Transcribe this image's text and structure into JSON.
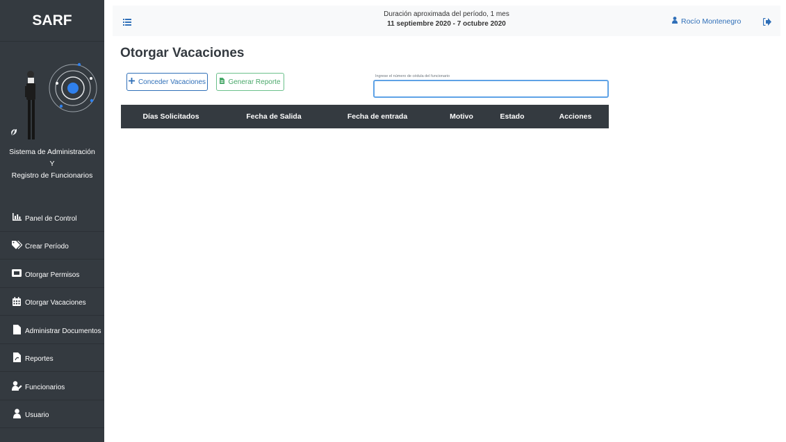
{
  "sidebar": {
    "brand": "SARF",
    "system_line1": "Sistema de Administración",
    "system_line2": "Y",
    "system_line3": "Registro de Funcionarios",
    "items": [
      {
        "label": "Panel de Control",
        "icon": "chart-icon"
      },
      {
        "label": "Crear Período",
        "icon": "tags-icon"
      },
      {
        "label": "Otorgar Permisos",
        "icon": "ticket-icon"
      },
      {
        "label": "Otorgar Vacaciones",
        "icon": "calendar-icon"
      },
      {
        "label": "Administrar Documentos",
        "icon": "file-icon"
      },
      {
        "label": "Reportes",
        "icon": "pdf-file-icon"
      },
      {
        "label": "Funcionarios",
        "icon": "user-edit-icon"
      },
      {
        "label": "Usuario",
        "icon": "user-icon"
      }
    ]
  },
  "topbar": {
    "period_line1": "Duración aproximada del período, 1 mes",
    "period_line2": "11 septiembre 2020 - 7 octubre 2020",
    "user_name": "Rocío Montenegro"
  },
  "main": {
    "title": "Otorgar Vacaciones",
    "grant_button": "Conceder Vacaciones",
    "report_button": "Generar Reporte",
    "search_label": "Ingrese el número de cédula del funcionario",
    "search_value": "",
    "table_headers": [
      "Días Solicitados",
      "Fecha de Salida",
      "Fecha de entrada",
      "Motivo",
      "Estado",
      "Acciones"
    ]
  },
  "colors": {
    "sidebar_bg": "#343a40",
    "primary": "#2f6fb8",
    "success": "#4aa86a",
    "table_head_bg": "#343a40"
  }
}
